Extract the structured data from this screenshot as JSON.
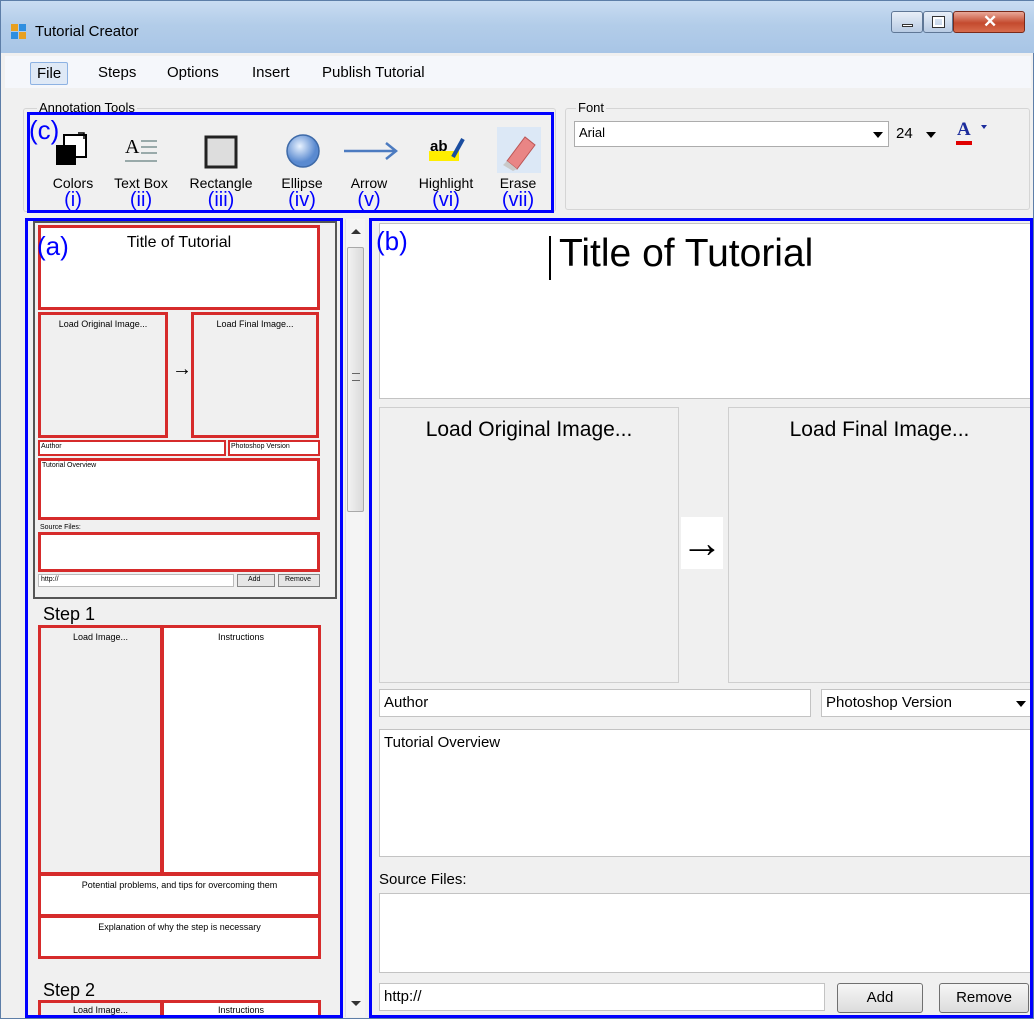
{
  "window": {
    "title": "Tutorial Creator"
  },
  "menu": {
    "items": [
      "File",
      "Steps",
      "Options",
      "Insert",
      "Publish Tutorial"
    ]
  },
  "annotation_tools": {
    "label": "Annotation Tools",
    "region_label": "(c)",
    "tools": [
      {
        "label": "Colors",
        "roman": "(i)",
        "icon": "colors-icon"
      },
      {
        "label": "Text Box",
        "roman": "(ii)",
        "icon": "textbox-icon"
      },
      {
        "label": "Rectangle",
        "roman": "(iii)",
        "icon": "rectangle-icon"
      },
      {
        "label": "Ellipse",
        "roman": "(iv)",
        "icon": "ellipse-icon"
      },
      {
        "label": "Arrow",
        "roman": "(v)",
        "icon": "arrow-icon"
      },
      {
        "label": "Highlight",
        "roman": "(vi)",
        "icon": "highlight-icon"
      },
      {
        "label": "Erase",
        "roman": "(vii)",
        "icon": "eraser-icon"
      }
    ]
  },
  "font": {
    "label": "Font",
    "family": "Arial",
    "size": "24",
    "color_glyph": "A"
  },
  "thumbnails": {
    "region_label": "(a)",
    "title": "Title of Tutorial",
    "load_original": "Load Original Image...",
    "load_final": "Load Final Image...",
    "arrow": "→",
    "author": "Author",
    "version": "Photoshop Version",
    "overview": "Tutorial Overview",
    "source_files": "Source Files:",
    "url": "http://",
    "add": "Add",
    "remove": "Remove",
    "step1": {
      "heading": "Step 1",
      "load_image": "Load Image...",
      "instructions": "Instructions",
      "problems": "Potential problems, and tips for overcoming them",
      "explanation": "Explanation of why the step is necessary"
    },
    "step2": {
      "heading": "Step 2",
      "load_image": "Load Image...",
      "instructions": "Instructions"
    }
  },
  "editor": {
    "region_label": "(b)",
    "title": "Title of Tutorial",
    "load_original": "Load Original Image...",
    "load_final": "Load Final Image...",
    "arrow": "→",
    "author": "Author",
    "version": "Photoshop Version",
    "overview": "Tutorial Overview",
    "source_files_label": "Source Files:",
    "url": "http://",
    "add": "Add",
    "remove": "Remove"
  },
  "colors": {
    "annotation_blue": "#0000ff",
    "thumbnail_red": "#d62b2b",
    "font_color_red": "#e00000"
  }
}
